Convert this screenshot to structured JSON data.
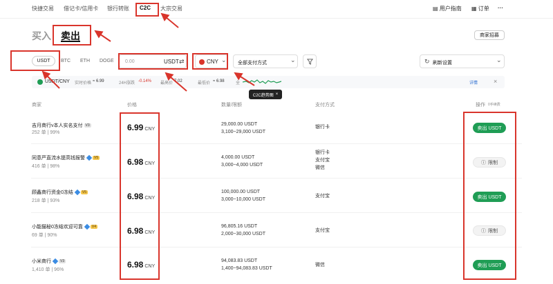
{
  "topnav": {
    "tabs": [
      "快捷交易",
      "借记卡/信用卡",
      "银行转账",
      "C2C",
      "大宗交易"
    ],
    "user_guide": "用户指南",
    "orders": "订单",
    "more": "···"
  },
  "mode": {
    "buy": "买入",
    "sell": "卖出",
    "merchant_recruit": "商家招募"
  },
  "coins": [
    "USDT",
    "BTC",
    "ETH",
    "DOGE"
  ],
  "amount": {
    "value": "0.00",
    "unit": "USDT",
    "swap": "⇄"
  },
  "currency": {
    "value": "CNY",
    "chevron": "⌄"
  },
  "payment": {
    "value": "全部支付方式",
    "chevron": "⌄"
  },
  "refresh": {
    "value": "刷新设置",
    "chevron": "⌄"
  },
  "ticker": {
    "pair": "USDT/CNY",
    "index_label": "实时价格",
    "index_value": "≈ 6.99",
    "change_label": "24H涨跌",
    "change_value": "-0.14%",
    "high_label": "最高价",
    "high_value": "7.02",
    "low_label": "最低价",
    "low_value": "≈ 6.98",
    "more": "全",
    "details": "详情",
    "close": "×",
    "tooltip": "C2C趋势图",
    "tooltip_close": "×"
  },
  "table_headers": {
    "merchant": "商家",
    "price": "价格",
    "qty": "数量/限额",
    "payment": "支付方式",
    "action": "操作",
    "zero_fee": "0手续费"
  },
  "rows": [
    {
      "merchant": "吉月商行v本人实名支付",
      "badge": "V3",
      "stats": "252 单 | 99%",
      "price": "6.99",
      "currency": "CNY",
      "qty": "29,000.00 USDT",
      "limit": "3,100~29,000 USDT",
      "payments": [
        "银行卡"
      ],
      "action": "卖出 USDT",
      "action_type": "sell"
    },
    {
      "merchant": "同意严直流水提高钱报警",
      "badge": "V5",
      "stats": "416 单 | 98%",
      "price": "6.98",
      "currency": "CNY",
      "qty": "4,000.00 USDT",
      "limit": "3,000~4,000 USDT",
      "payments": [
        "银行卡",
        "支付宝",
        "微信"
      ],
      "action": "限制",
      "action_type": "limit"
    },
    {
      "merchant": "顾鑫商行资金0冻结",
      "badge": "V5",
      "stats": "218 单 | 93%",
      "price": "6.98",
      "currency": "CNY",
      "qty": "100,000.00 USDT",
      "limit": "3,000~10,000 USDT",
      "payments": [
        "支付宝"
      ],
      "action": "卖出 USDT",
      "action_type": "sell"
    },
    {
      "merchant": "小能猫秘0冻结欢迎可靠",
      "badge": "V4",
      "stats": "69 单 | 90%",
      "price": "6.98",
      "currency": "CNY",
      "qty": "96,805.16 USDT",
      "limit": "2,000~30,000 USDT",
      "payments": [
        "支付宝"
      ],
      "action": "限制",
      "action_type": "limit"
    },
    {
      "merchant": "小米商行",
      "badge": "V3",
      "stats": "1,410 单 | 96%",
      "price": "6.98",
      "currency": "CNY",
      "qty": "94,083.83 USDT",
      "limit": "1,400~94,083.83 USDT",
      "payments": [
        "微信"
      ],
      "action": "卖出 USDT",
      "action_type": "sell"
    }
  ],
  "colors": {
    "accent_red": "#d9342b",
    "sell_green": "#1f9d55",
    "ticker_green": "#1f9d55"
  }
}
